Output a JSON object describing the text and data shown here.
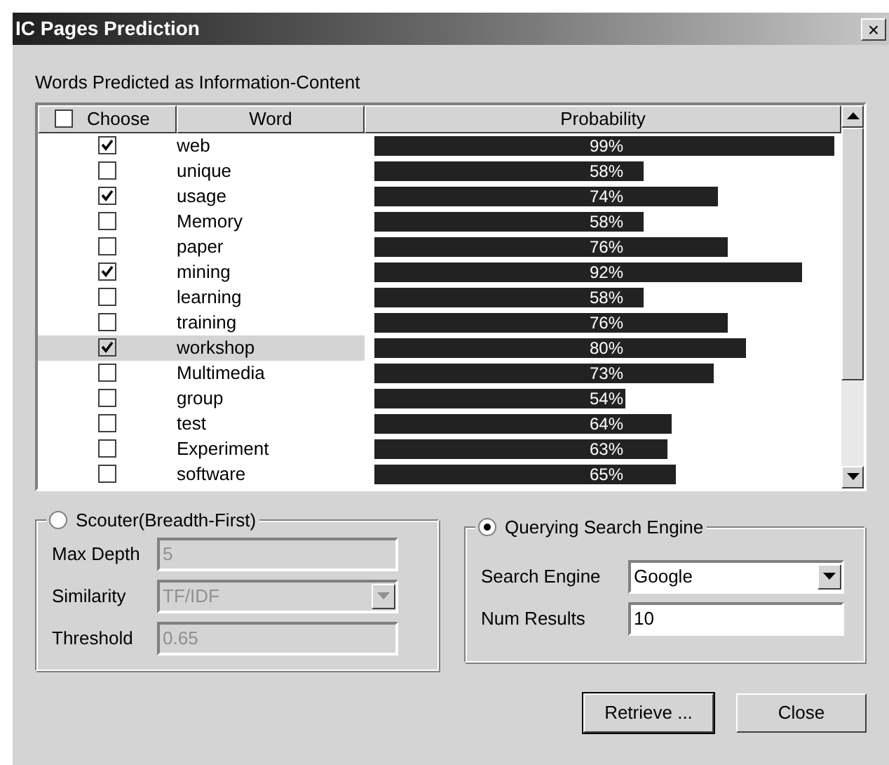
{
  "window": {
    "title": "IC Pages Prediction",
    "close": "×"
  },
  "list_label": "Words Predicted as Information-Content",
  "table": {
    "select_all_checked": false,
    "columns": [
      "Choose",
      "Word",
      "Probability"
    ],
    "rows": [
      {
        "checked": true,
        "word": "web",
        "level": 0.99,
        "probability": "99%",
        "selected": false
      },
      {
        "checked": false,
        "word": "unique",
        "level": 0.58,
        "probability": "58%",
        "selected": false
      },
      {
        "checked": true,
        "word": "usage",
        "level": 0.74,
        "probability": "74%",
        "selected": false
      },
      {
        "checked": false,
        "word": "Memory",
        "level": 0.58,
        "probability": "58%",
        "selected": false
      },
      {
        "checked": false,
        "word": "paper",
        "level": 0.76,
        "probability": "76%",
        "selected": false
      },
      {
        "checked": true,
        "word": "mining",
        "level": 0.92,
        "probability": "92%",
        "selected": false
      },
      {
        "checked": false,
        "word": "learning",
        "level": 0.58,
        "probability": "58%",
        "selected": false
      },
      {
        "checked": false,
        "word": "training",
        "level": 0.76,
        "probability": "76%",
        "selected": false
      },
      {
        "checked": true,
        "word": "workshop",
        "level": 0.8,
        "probability": "80%",
        "selected": true
      },
      {
        "checked": false,
        "word": "Multimedia",
        "level": 0.73,
        "probability": "73%",
        "selected": false
      },
      {
        "checked": false,
        "word": "group",
        "level": 0.54,
        "probability": "54%",
        "selected": false
      },
      {
        "checked": false,
        "word": "test",
        "level": 0.64,
        "probability": "64%",
        "selected": false
      },
      {
        "checked": false,
        "word": "Experiment",
        "level": 0.63,
        "probability": "63%",
        "selected": false
      },
      {
        "checked": false,
        "word": "software",
        "level": 0.65,
        "probability": "65%",
        "selected": false
      }
    ]
  },
  "scouter": {
    "label": "Scouter(Breadth-First)",
    "selected": false,
    "disabled": true,
    "fields": [
      {
        "kind": "text",
        "label": "Max Depth",
        "value": "5"
      },
      {
        "kind": "select",
        "label": "Similarity",
        "value": "TF/IDF"
      },
      {
        "kind": "text",
        "label": "Threshold",
        "value": "0.65"
      }
    ]
  },
  "search_engine": {
    "label": "Querying Search Engine",
    "selected": true,
    "disabled": false,
    "fields": [
      {
        "kind": "select",
        "label": "Search Engine",
        "value": "Google"
      },
      {
        "kind": "text",
        "label": "Num Results",
        "value": "10"
      }
    ]
  },
  "buttons": [
    {
      "label": "Retrieve ...",
      "default": true
    },
    {
      "label": "Close",
      "default": false
    }
  ]
}
